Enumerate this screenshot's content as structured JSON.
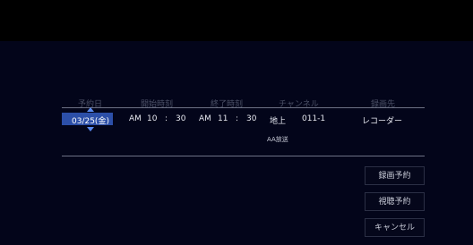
{
  "columns": {
    "date": "予約日",
    "start_time": "開始時刻",
    "end_time": "終了時刻",
    "channel": "チャンネル",
    "destination": "録画先"
  },
  "reservation": {
    "date": "03/25(金)",
    "start_ampm": "AM",
    "start_hour": "10",
    "start_sep": ":",
    "start_minute": "30",
    "end_ampm": "AM",
    "end_hour": "11",
    "end_sep": ":",
    "end_minute": "30",
    "channel_type": "地上",
    "channel_number": "011-1",
    "station": "AA放送",
    "destination": "レコーダー"
  },
  "buttons": {
    "record": "録画予約",
    "watch": "視聴予約",
    "cancel": "キャンセル"
  },
  "colors": {
    "background": "#03051a",
    "selection": "#2c4fa8",
    "arrow": "#5a8af0"
  }
}
